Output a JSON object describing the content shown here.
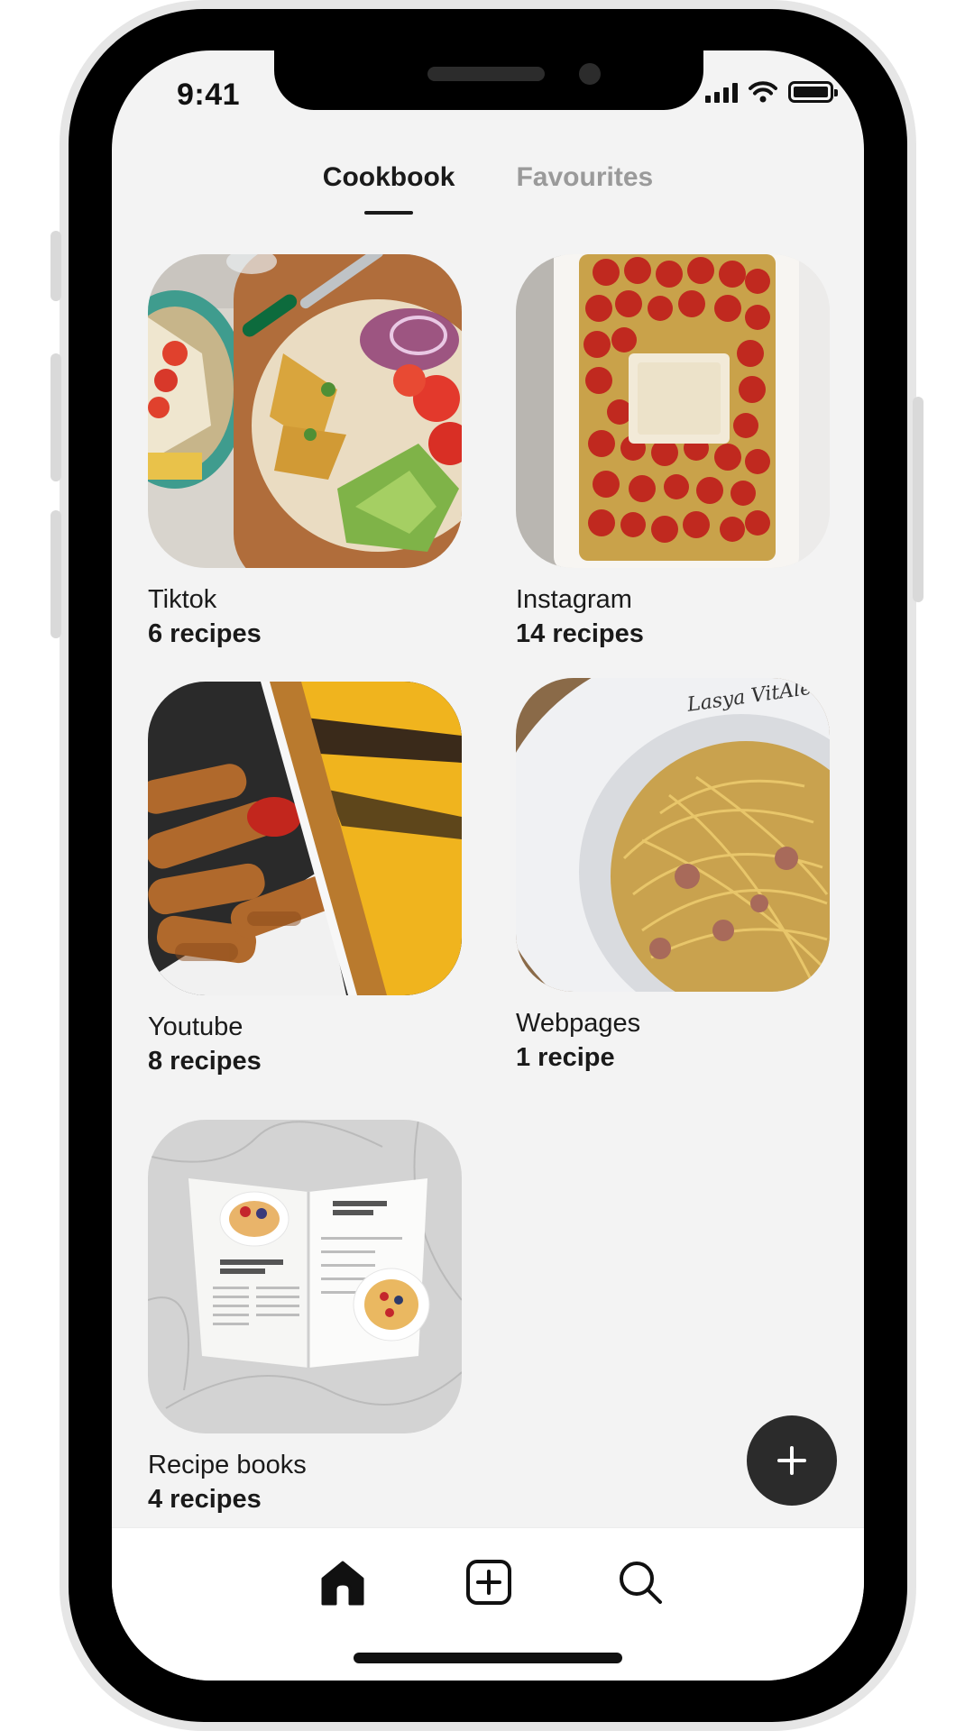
{
  "status_bar": {
    "time": "9:41",
    "icons": [
      "signal-icon",
      "wifi-icon",
      "battery-icon"
    ]
  },
  "tabs": [
    {
      "label": "Cookbook",
      "active": true
    },
    {
      "label": "Favourites",
      "active": false
    }
  ],
  "collections": [
    {
      "title": "Tiktok",
      "count": "6 recipes",
      "image": "wrap-pizza-food-photo"
    },
    {
      "title": "Instagram",
      "count": "14 recipes",
      "image": "baked-feta-tomato-photo"
    },
    {
      "title": "Youtube",
      "count": "8 recipes",
      "image": "mozzarella-sticks-photo"
    },
    {
      "title": "Webpages",
      "count": "1 recipe",
      "image": "spaghetti-carbonara-photo"
    },
    {
      "title": "Recipe books",
      "count": "4 recipes",
      "image": "open-recipe-book-photo"
    }
  ],
  "fab": {
    "icon": "plus-icon"
  },
  "bottom_nav": [
    {
      "icon": "home-icon",
      "active": true
    },
    {
      "icon": "add-square-icon",
      "active": false
    },
    {
      "icon": "search-icon",
      "active": false
    }
  ],
  "colors": {
    "background": "#f3f3f3",
    "text": "#1a1a1a",
    "inactive_tab": "#9a9a9a",
    "fab": "#2b2b2b"
  }
}
